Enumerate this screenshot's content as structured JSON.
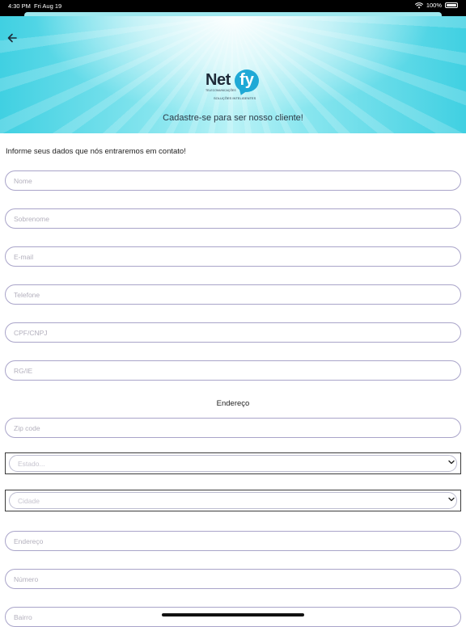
{
  "status_bar": {
    "time": "4:30 PM",
    "date": "Fri Aug 19",
    "battery": "100%"
  },
  "header": {
    "logo": {
      "net": "Net",
      "fy": "fy",
      "tagline_small": "TELECOMUNICAÇÕES",
      "tagline": "SOLUÇÕES INTELIGENTES"
    },
    "title": "Cadastre-se para ser nosso cliente!"
  },
  "form": {
    "intro": "Informe seus dados que nós entraremos em contato!",
    "fields": {
      "nome": "Nome",
      "sobrenome": "Sobrenome",
      "email": "E-mail",
      "telefone": "Telefone",
      "cpf": "CPF/CNPJ",
      "rg": "RG/IE"
    },
    "address_section": "Endereço",
    "address": {
      "zip": "Zip code",
      "estado": "Estado...",
      "cidade": "Cidade",
      "endereco": "Endereço",
      "numero": "Número",
      "bairro": "Bairro"
    }
  },
  "colors": {
    "accent": "#40d0e2",
    "field_border": "#a9a4c9",
    "placeholder": "#b3b0bd"
  }
}
